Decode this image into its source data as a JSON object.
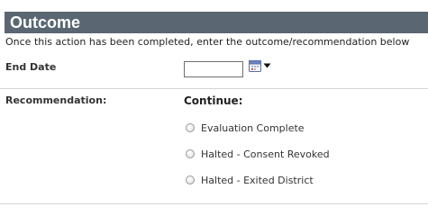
{
  "section": {
    "title": "Outcome",
    "instructions": "Once this action has been completed, enter the outcome/recommendation below"
  },
  "end_date": {
    "label": "End Date",
    "value": "",
    "calendar_icon": "calendar-icon",
    "dropdown_icon": "caret-down-icon"
  },
  "recommendation": {
    "label": "Recommendation:",
    "heading": "Continue:",
    "options": [
      {
        "label": "Evaluation Complete",
        "selected": false
      },
      {
        "label": "Halted - Consent Revoked",
        "selected": false
      },
      {
        "label": "Halted - Exited District",
        "selected": false
      }
    ]
  },
  "colors": {
    "header_background": "#5a6772",
    "header_text": "#ffffff",
    "divider": "#d4d4d4",
    "calendar_accent": "#c0392b"
  }
}
